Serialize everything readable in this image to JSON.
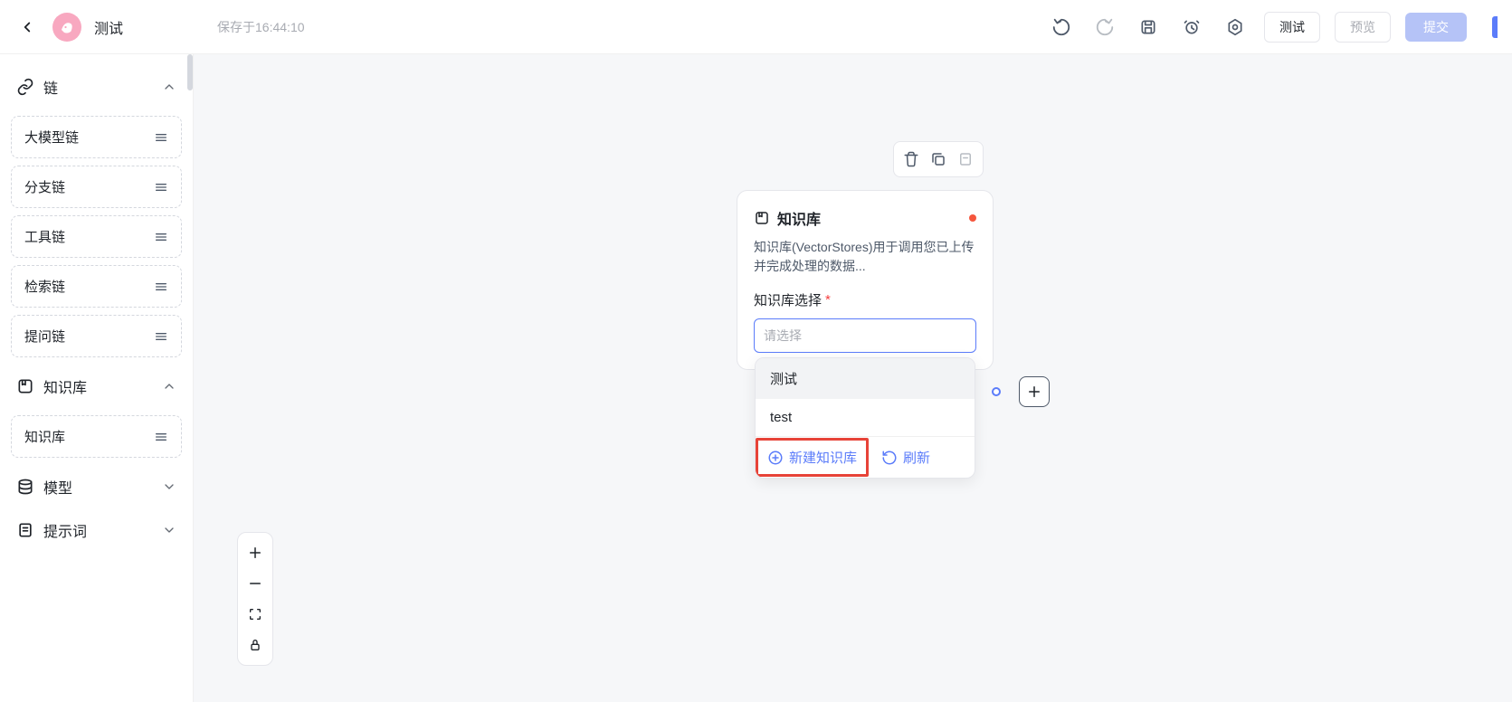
{
  "header": {
    "page_title": "测试",
    "save_time": "保存于16:44:10",
    "test_btn": "测试",
    "preview_btn": "预览",
    "submit_btn": "提交"
  },
  "sidebar": {
    "sections": {
      "chain": {
        "label": "链"
      },
      "knowledge": {
        "label": "知识库"
      },
      "model": {
        "label": "模型"
      },
      "prompt": {
        "label": "提示词"
      }
    },
    "chain_items": [
      "大模型链",
      "分支链",
      "工具链",
      "检索链",
      "提问链"
    ],
    "knowledge_items": [
      "知识库"
    ]
  },
  "node": {
    "title": "知识库",
    "description": "知识库(VectorStores)用于调用您已上传并完成处理的数据...",
    "field_label": "知识库选择",
    "select_placeholder": "请选择"
  },
  "dropdown": {
    "options": [
      "测试",
      "test"
    ],
    "create_label": "新建知识库",
    "refresh_label": "刷新"
  }
}
